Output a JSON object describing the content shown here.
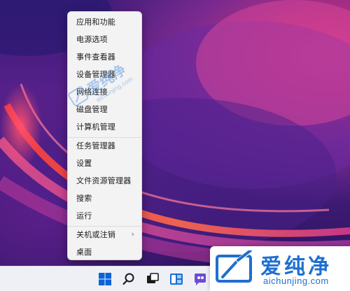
{
  "context_menu": {
    "items": [
      {
        "label": "应用和功能"
      },
      {
        "label": "电源选项"
      },
      {
        "label": "事件查看器"
      },
      {
        "label": "设备管理器"
      },
      {
        "label": "网络连接"
      },
      {
        "label": "磁盘管理"
      },
      {
        "label": "计算机管理"
      },
      {
        "label": "任务管理器"
      },
      {
        "label": "设置"
      },
      {
        "label": "文件资源管理器"
      },
      {
        "label": "搜索"
      },
      {
        "label": "运行"
      },
      {
        "label": "关机或注销",
        "submenu_indicator": "›"
      },
      {
        "label": "桌面"
      }
    ]
  },
  "watermark": {
    "text_cn": "爱纯净",
    "url": "aichunjing.com"
  },
  "logo": {
    "text_cn": "爱纯净",
    "url": "aichunjing.com",
    "color": "#1e6fd0"
  },
  "taskbar": {
    "icons": [
      "windows-start-icon",
      "search-icon",
      "task-view-icon",
      "widgets-icon",
      "chat-icon"
    ]
  },
  "colors": {
    "menu_bg": "#f3f3f3",
    "taskbar_bg": "#eef0f5",
    "start_blue": "#0a64d8"
  }
}
